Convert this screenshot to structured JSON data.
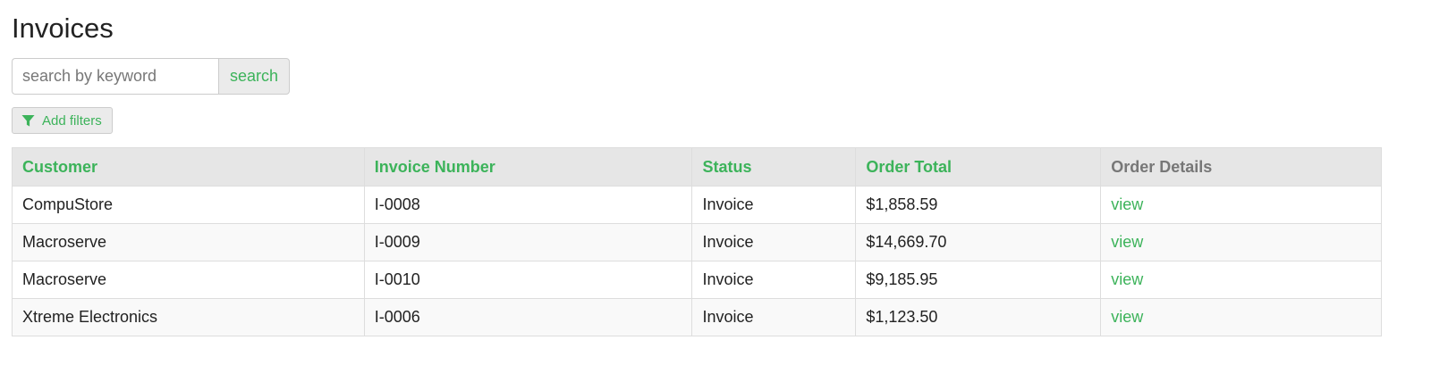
{
  "page": {
    "title": "Invoices"
  },
  "search": {
    "placeholder": "search by keyword",
    "value": "",
    "button_label": "search"
  },
  "filters": {
    "button_label": "Add filters",
    "icon": "filter-icon"
  },
  "table": {
    "headers": {
      "customer": "Customer",
      "invoice_number": "Invoice Number",
      "status": "Status",
      "order_total": "Order Total",
      "order_details": "Order Details"
    },
    "rows": [
      {
        "customer": "CompuStore",
        "invoice_number": "I-0008",
        "status": "Invoice",
        "order_total": "$1,858.59",
        "details_link": "view"
      },
      {
        "customer": "Macroserve",
        "invoice_number": "I-0009",
        "status": "Invoice",
        "order_total": "$14,669.70",
        "details_link": "view"
      },
      {
        "customer": "Macroserve",
        "invoice_number": "I-0010",
        "status": "Invoice",
        "order_total": "$9,185.95",
        "details_link": "view"
      },
      {
        "customer": "Xtreme Electronics",
        "invoice_number": "I-0006",
        "status": "Invoice",
        "order_total": "$1,123.50",
        "details_link": "view"
      }
    ]
  },
  "colors": {
    "accent": "#3cb35a",
    "header_bg": "#e6e6e6",
    "muted_header": "#777777",
    "border": "#dddddd"
  }
}
